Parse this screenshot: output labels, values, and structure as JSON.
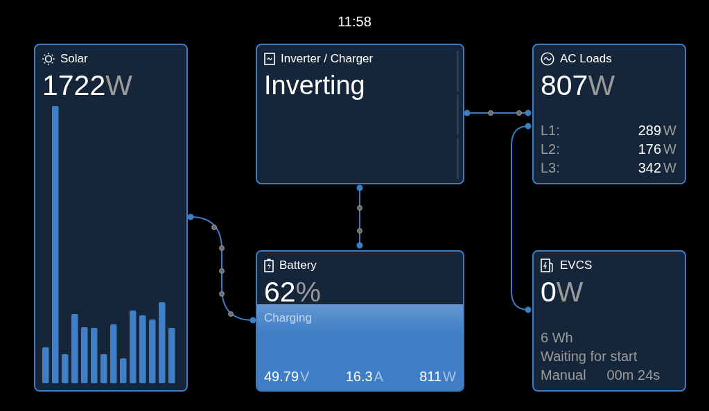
{
  "clock": "11:58",
  "solar": {
    "title": "Solar",
    "value": "1722",
    "unit": "W"
  },
  "inverter": {
    "title": "Inverter / Charger",
    "state": "Inverting"
  },
  "ac_loads": {
    "title": "AC Loads",
    "value": "807",
    "unit": "W",
    "phases": [
      {
        "label": "L1:",
        "value": "289",
        "unit": "W"
      },
      {
        "label": "L2:",
        "value": "176",
        "unit": "W"
      },
      {
        "label": "L3:",
        "value": "342",
        "unit": "W"
      }
    ]
  },
  "battery": {
    "title": "Battery",
    "value": "62",
    "unit": "%",
    "state": "Charging",
    "readings": [
      {
        "value": "49.79",
        "unit": "V"
      },
      {
        "value": "16.3",
        "unit": "A"
      },
      {
        "value": "811",
        "unit": "W"
      }
    ]
  },
  "evcs": {
    "title": "EVCS",
    "value": "0",
    "unit": "W",
    "energy": "6 Wh",
    "status": "Waiting for start",
    "mode": "Manual",
    "time": "00m 24s"
  }
}
